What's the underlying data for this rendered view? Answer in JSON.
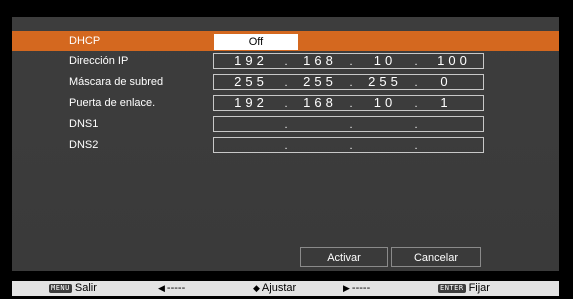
{
  "settings": {
    "rows": [
      {
        "label": "DHCP",
        "value": "Off"
      },
      {
        "label": "Dirección IP",
        "octets": [
          "192",
          "168",
          "10",
          "100"
        ],
        "dots": [
          ".",
          ".",
          "."
        ]
      },
      {
        "label": "Máscara de subred",
        "octets": [
          "255",
          "255",
          "255",
          "0"
        ],
        "dots": [
          ".",
          ".",
          "."
        ]
      },
      {
        "label": "Puerta de enlace.",
        "octets": [
          "192",
          "168",
          "10",
          "1"
        ],
        "dots": [
          ".",
          ".",
          "."
        ]
      },
      {
        "label": "DNS1",
        "octets": [
          "",
          "",
          "",
          ""
        ],
        "dots": [
          ".",
          ".",
          "."
        ]
      },
      {
        "label": "DNS2",
        "octets": [
          "",
          "",
          "",
          ""
        ],
        "dots": [
          ".",
          ".",
          "."
        ]
      }
    ]
  },
  "buttons": {
    "activate": "Activar",
    "cancel": "Cancelar"
  },
  "footer": {
    "menu_key": "MENU",
    "menu_label": "Salir",
    "left_label": "-----",
    "adjust_label": "Ajustar",
    "right_label": "-----",
    "enter_key": "ENTER",
    "enter_label": "Fijar"
  },
  "colors": {
    "background": "#000000",
    "panel": "#3d3d3d",
    "selection": "#d4681f",
    "footer": "#e3e3e3"
  },
  "icons": {
    "left": "triangle-left",
    "adjust": "up-down-arrows",
    "right": "triangle-right"
  }
}
